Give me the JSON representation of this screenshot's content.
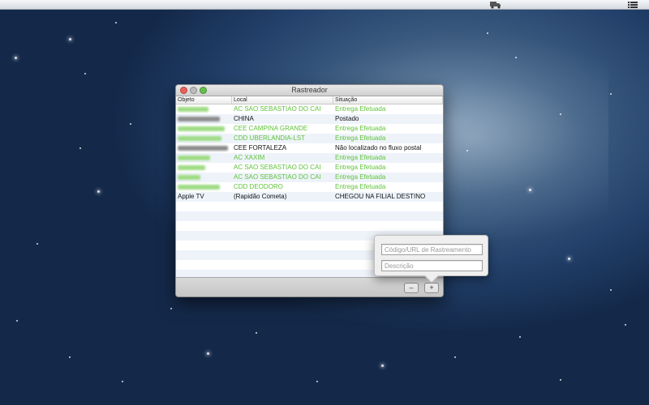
{
  "window": {
    "title": "Rastreador"
  },
  "table": {
    "headers": [
      "Objeto",
      "Local",
      "Situação"
    ],
    "rows": [
      {
        "objeto": "",
        "local": "AC SAO SEBASTIAO DO CAI",
        "situacao": "Entrega Efetuada",
        "status": "delivered"
      },
      {
        "objeto": "",
        "local": "CHINA",
        "situacao": "Postado",
        "status": "normal"
      },
      {
        "objeto": "",
        "local": "CEE CAMPINA GRANDE",
        "situacao": "Entrega Efetuada",
        "status": "delivered"
      },
      {
        "objeto": "",
        "local": "CDD UBERLANDIA-LST",
        "situacao": "Entrega Efetuada",
        "status": "delivered"
      },
      {
        "objeto": "",
        "local": "CEE FORTALEZA",
        "situacao": "Não localizado no fluxo postal",
        "status": "normal"
      },
      {
        "objeto": "",
        "local": "AC XAXIM",
        "situacao": "Entrega Efetuada",
        "status": "delivered"
      },
      {
        "objeto": "",
        "local": "AC SAO SEBASTIAO DO CAI",
        "situacao": "Entrega Efetuada",
        "status": "delivered"
      },
      {
        "objeto": "",
        "local": "AC SAO SEBASTIAO DO CAI",
        "situacao": "Entrega Efetuada",
        "status": "delivered"
      },
      {
        "objeto": "",
        "local": "CDD DEODORO",
        "situacao": "Entrega Efetuada",
        "status": "delivered"
      },
      {
        "objeto": "Apple TV",
        "local": "(Rapidão Cometa)",
        "situacao": "CHEGOU NA FILIAL DESTINO",
        "status": "normal"
      }
    ],
    "empty_rows": 8
  },
  "buttons": {
    "remove": "–",
    "add": "+"
  },
  "popover": {
    "code_placeholder": "Código/URL de Rastreamento",
    "desc_placeholder": "Descrição"
  },
  "menubar": {
    "icons": [
      "truck-icon",
      "list-icon"
    ]
  },
  "colors": {
    "delivered": "#5fc33a",
    "normal": "#111111",
    "close": "#ec5f57",
    "zoom": "#63c14a"
  }
}
